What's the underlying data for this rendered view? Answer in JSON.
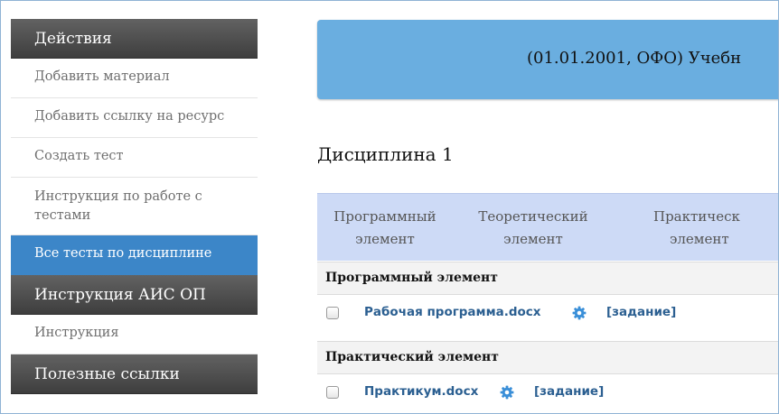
{
  "sidebar": {
    "sections": [
      {
        "title": "Действия",
        "items": [
          {
            "label": "Добавить материал"
          },
          {
            "label": "Добавить ссылку на ресурс"
          },
          {
            "label": "Создать тест"
          },
          {
            "label": "Инструкция по работе с",
            "label2": "тестами"
          },
          {
            "label": "Все тесты по дисциплине",
            "active": true
          }
        ]
      },
      {
        "title": "Инструкция АИС ОП",
        "items": [
          {
            "label": "Инструкция"
          }
        ]
      },
      {
        "title": "Полезные ссылки",
        "items": []
      }
    ]
  },
  "banner": {
    "text": "(01.01.2001, ОФО) Учебн"
  },
  "discipline": {
    "title": "Дисциплина 1"
  },
  "table": {
    "columns": [
      {
        "line1": "Программный",
        "line2": "элемент"
      },
      {
        "line1": "Теоретический",
        "line2": "элемент"
      },
      {
        "line1": "Практическ",
        "line2": "элемент"
      }
    ],
    "sections": [
      {
        "label": "Программный элемент",
        "files": [
          {
            "name": "Рабочая программа.docx",
            "task": "[задание]"
          }
        ]
      },
      {
        "label": "Практический элемент",
        "files": [
          {
            "name": "Практикум.docx",
            "task": "[задание]"
          }
        ]
      }
    ]
  },
  "colors": {
    "sidebar_header": "#4a4a4a",
    "sidebar_active": "#3c86c8",
    "banner": "#6aaee0",
    "table_header": "#cddaf6",
    "link": "#2b5f91",
    "gear": "#3a8fd8"
  },
  "icons": {
    "gear": "gear-icon"
  }
}
